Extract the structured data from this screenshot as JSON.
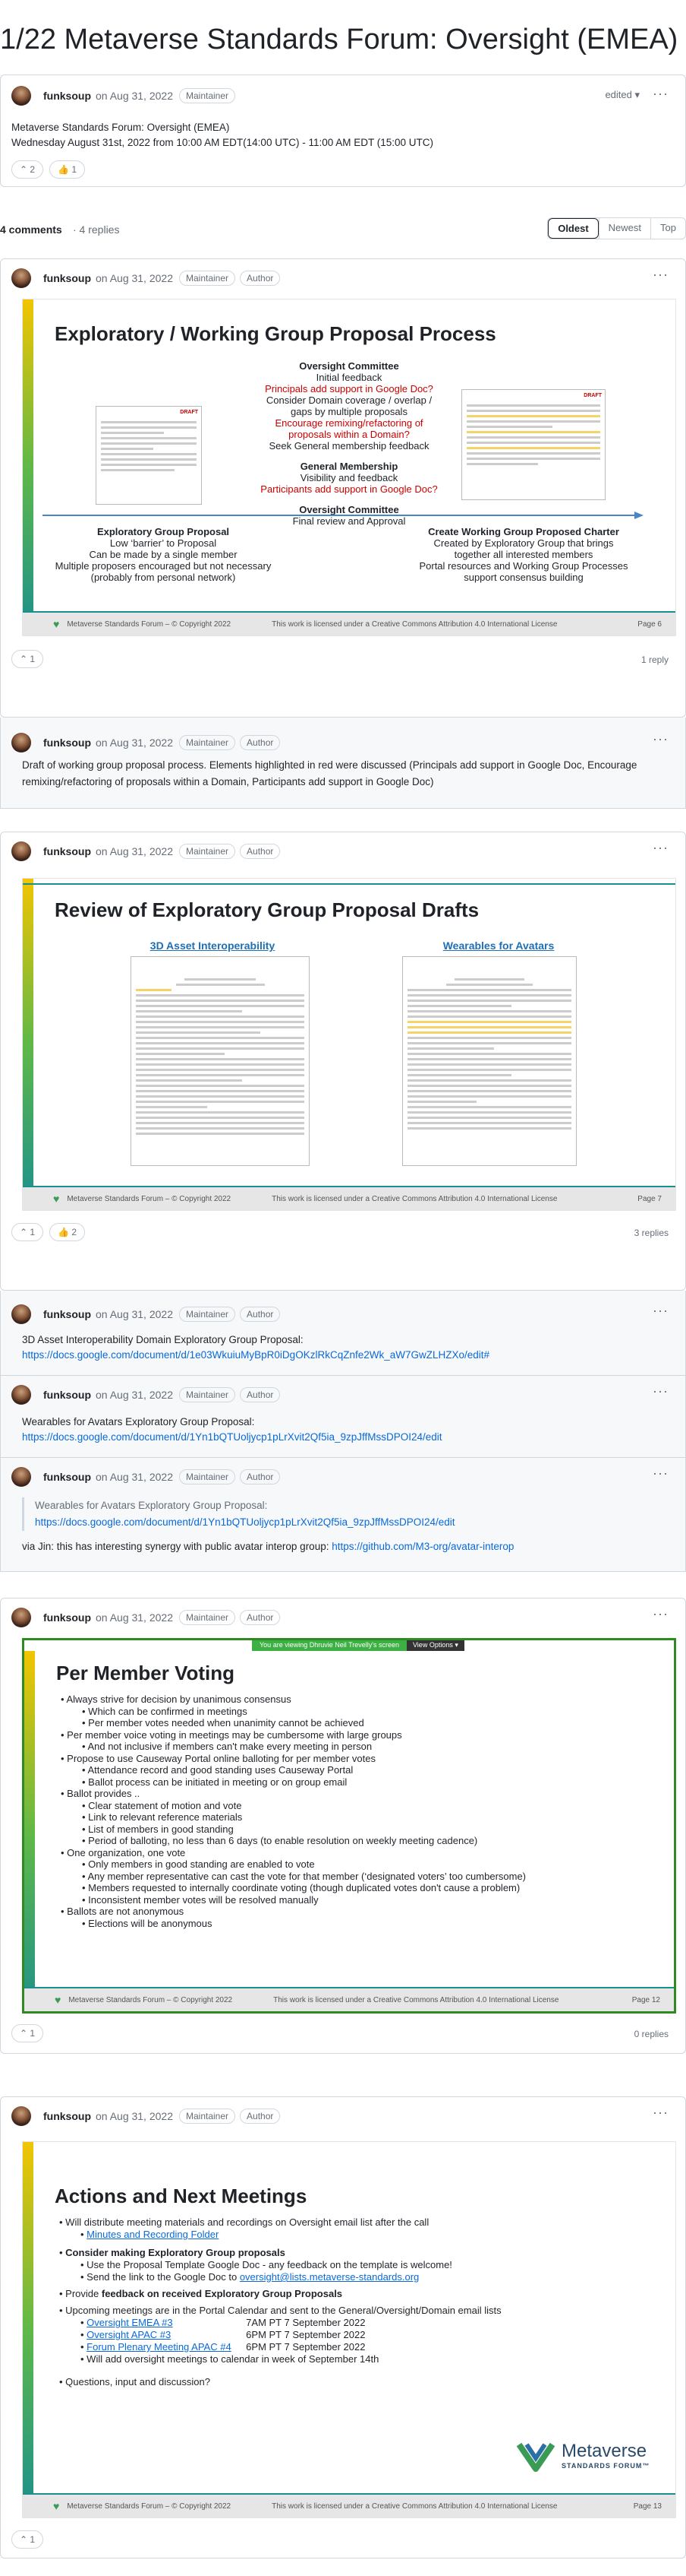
{
  "page_title": "1/22 Metaverse Standards Forum: Oversight (EMEA)",
  "header_post": {
    "user": "funksoup",
    "date": "on Aug 31, 2022",
    "badge": "Maintainer",
    "edited": "edited ▾",
    "line1": "Metaverse Standards Forum: Oversight (EMEA)",
    "line2": "Wednesday August 31st, 2022 from 10:00 AM EDT(14:00 UTC) - 11:00 AM EDT (15:00 UTC)",
    "r1": "⌃ 2",
    "r2": "👍 1"
  },
  "summary": {
    "comments": "4 comments",
    "replies": "· 4 replies",
    "sort": [
      "Oldest",
      "Newest",
      "Top"
    ]
  },
  "badges": {
    "maintainer": "Maintainer",
    "author": "Author"
  },
  "footer": {
    "org": "Metaverse Standards Forum – © Copyright 2022",
    "license": "This work is licensed under a Creative Commons Attribution 4.0 International License"
  },
  "c1": {
    "user": "funksoup",
    "date": "on Aug 31, 2022",
    "slide_title": "Exploratory / Working Group Proposal Process",
    "center": [
      "Oversight Committee",
      "Initial feedback",
      "Principals add support in Google Doc?",
      "Consider Domain coverage / overlap /",
      "gaps by multiple proposals",
      "Encourage remixing/refactoring of",
      "proposals within a Domain?",
      "Seek General membership feedback"
    ],
    "center2": [
      "General Membership",
      "Visibility and feedback",
      "Participants add support in Google Doc?"
    ],
    "center3": [
      "Oversight Committee",
      "Final review and Approval"
    ],
    "left": [
      "Exploratory Group Proposal",
      "Low ‘barrier’ to Proposal",
      "Can be made by a single member",
      "Multiple proposers encouraged but not necessary",
      "(probably from personal network)"
    ],
    "right": [
      "Create Working Group Proposed Charter",
      "Created by Exploratory Group that brings",
      "together all interested members",
      "Portal resources and Working Group Processes",
      "support consensus building"
    ],
    "page": "Page 6",
    "draft": "DRAFT",
    "react": "⌃ 1",
    "replies": "1 reply",
    "reply_user": "funksoup",
    "reply_date": "on Aug 31, 2022",
    "reply_text": "Draft of working group proposal process. Elements highlighted in red were discussed (Principals add support in Google Doc, Encourage remixing/refactoring of proposals within a Domain, Participants add support in Google Doc)"
  },
  "c2": {
    "user": "funksoup",
    "date": "on Aug 31, 2022",
    "slide_title": "Review of Exploratory Group Proposal Drafts",
    "doc1": "3D Asset Interoperability",
    "doc2": "Wearables for Avatars",
    "page": "Page 7",
    "r1": "⌃ 1",
    "r2": "👍 2",
    "replies": "3 replies",
    "rp1_text": "3D Asset Interoperability Domain Exploratory Group Proposal:",
    "rp1_link": "https://docs.google.com/document/d/1e03WkuiuMyBpR0iDgOKzlRkCqZnfe2Wk_aW7GwZLHZXo/edit#",
    "rp2_text": "Wearables for Avatars Exploratory Group Proposal:",
    "rp2_link": "https://docs.google.com/document/d/1Yn1bQTUoljycp1pLrXvit2Qf5ia_9zpJffMssDPOI24/edit",
    "rp3_quote": "Wearables for Avatars Exploratory Group Proposal:",
    "rp3_qlink": "https://docs.google.com/document/d/1Yn1bQTUoljycp1pLrXvit2Qf5ia_9zpJffMssDPOI24/edit",
    "rp3_text": "via Jin: this has interesting synergy with public avatar interop group:",
    "rp3_link": "https://github.com/M3-org/avatar-interop"
  },
  "c3": {
    "user": "funksoup",
    "date": "on Aug 31, 2022",
    "banner": "You are viewing Dhruvie Neil Trevelly's screen",
    "view": "View Options ▾",
    "slide_title": "Per Member Voting",
    "bullets": [
      {
        "t": "Always strive for decision by unanimous consensus",
        "s": [
          "Which can be confirmed in meetings",
          "Per member votes needed when unanimity cannot be achieved"
        ]
      },
      {
        "t": "Per member voice voting in meetings may be cumbersome with large groups",
        "s": [
          "And not inclusive if members can't make every meeting in person"
        ]
      },
      {
        "t": "Propose to use Causeway Portal online balloting for per member votes",
        "s": [
          "Attendance record and good standing uses Causeway Portal",
          "Ballot process can be initiated in meeting or on group email"
        ]
      },
      {
        "t": "Ballot provides ..",
        "s": [
          "Clear statement of motion and vote",
          "Link to relevant reference materials",
          "List of members in good standing",
          "Period of balloting, no less than 6 days (to enable resolution on weekly meeting cadence)"
        ]
      },
      {
        "t": "One organization, one vote",
        "s": [
          "Only members in good standing are enabled to vote",
          "Any member representative can cast the vote for that member (‘designated voters’ too cumbersome)",
          "Members requested to internally coordinate voting (though duplicated votes don't cause a problem)",
          "Inconsistent member votes will be resolved manually"
        ]
      },
      {
        "t": "Ballots are not anonymous",
        "s": [
          "Elections will be anonymous"
        ]
      }
    ],
    "page": "Page 12",
    "react": "⌃ 1",
    "replies": "0 replies"
  },
  "c4": {
    "user": "funksoup",
    "date": "on Aug 31, 2022",
    "slide_title": "Actions and Next Meetings",
    "b1": "Will distribute meeting materials and recordings on Oversight email list after the call",
    "b1s": "Minutes and Recording Folder",
    "b2": "Consider making Exploratory Group proposals",
    "b2s1": "Use the Proposal Template Google Doc - any feedback on the template is welcome!",
    "b2s2": "Send the link to the Google Doc to ",
    "b2s2l": "oversight@lists.metaverse-standards.org",
    "b3a": "Provide ",
    "b3b": "feedback on received Exploratory Group Proposals",
    "b4": "Upcoming meetings are in the Portal Calendar and sent to the General/Oversight/Domain email lists",
    "meetings": [
      {
        "n": "Oversight EMEA #3",
        "t": "7AM PT 7 September 2022"
      },
      {
        "n": "Oversight APAC #3",
        "t": "6PM PT 7 September 2022"
      },
      {
        "n": "Forum Plenary Meeting APAC #4",
        "t": "6PM PT 7 September 2022"
      }
    ],
    "b4s": "Will add oversight meetings to calendar in week of September 14th",
    "b5": "Questions, input and discussion?",
    "logo1": "Metaverse",
    "logo2": "STANDARDS FORUM™",
    "page": "Page 13",
    "react": "⌃ 1"
  }
}
